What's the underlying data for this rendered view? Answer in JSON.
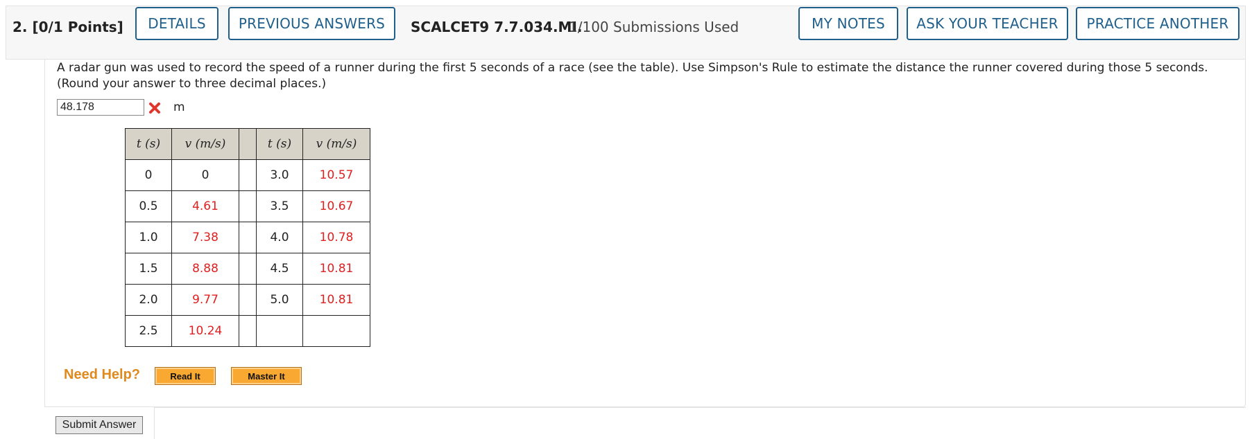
{
  "header": {
    "question_number": "2.  [0/1 Points]",
    "details_label": "DETAILS",
    "previous_answers_label": "PREVIOUS ANSWERS",
    "problem_code": "SCALCET9 7.7.034.MI.",
    "submissions": "1/100 Submissions Used",
    "my_notes_label": "MY NOTES",
    "ask_teacher_label": "ASK YOUR TEACHER",
    "practice_another_label": "PRACTICE ANOTHER",
    "accent_color": "#1f5f8b"
  },
  "question": {
    "text": "A radar gun was used to record the speed of a runner during the first 5 seconds of a race (see the table). Use Simpson's Rule to estimate the distance the runner covered during those 5 seconds. (Round your answer to three decimal places.)",
    "answer_value": "48.178",
    "answer_status": "incorrect",
    "unit": "m"
  },
  "table": {
    "headers": {
      "t": "t (s)",
      "v": "v (m/s)"
    },
    "left": [
      {
        "t": "0",
        "v": "0",
        "v_red": false
      },
      {
        "t": "0.5",
        "v": "4.61",
        "v_red": true
      },
      {
        "t": "1.0",
        "v": "7.38",
        "v_red": true
      },
      {
        "t": "1.5",
        "v": "8.88",
        "v_red": true
      },
      {
        "t": "2.0",
        "v": "9.77",
        "v_red": true
      },
      {
        "t": "2.5",
        "v": "10.24",
        "v_red": true
      }
    ],
    "right": [
      {
        "t": "3.0",
        "v": "10.57"
      },
      {
        "t": "3.5",
        "v": "10.67"
      },
      {
        "t": "4.0",
        "v": "10.78"
      },
      {
        "t": "4.5",
        "v": "10.81"
      },
      {
        "t": "5.0",
        "v": "10.81"
      },
      {
        "t": "",
        "v": ""
      }
    ]
  },
  "help": {
    "label": "Need Help?",
    "read_it": "Read It",
    "master_it": "Master It"
  },
  "submit_label": "Submit Answer"
}
